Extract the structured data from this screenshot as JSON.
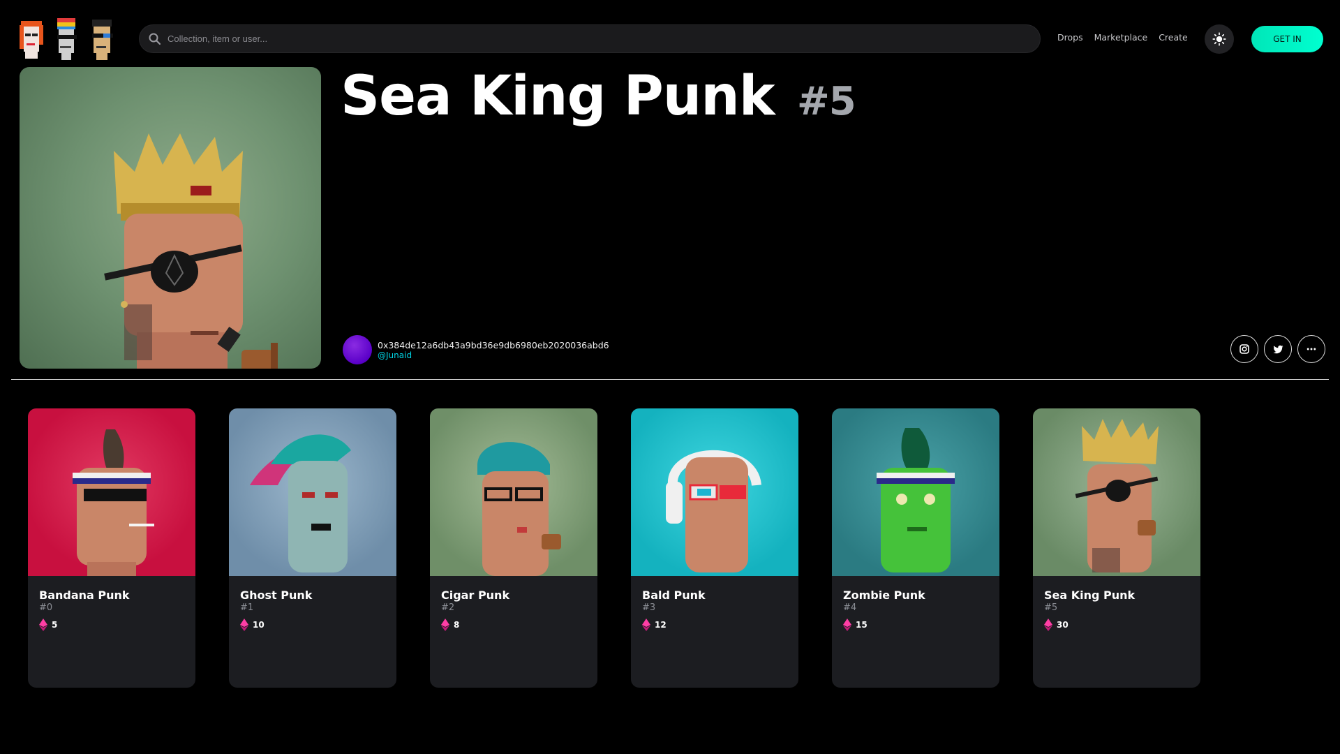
{
  "header": {
    "search_placeholder": "Collection, item or user...",
    "nav": [
      {
        "label": "Drops"
      },
      {
        "label": "Marketplace"
      },
      {
        "label": "Create"
      }
    ],
    "get_in_label": "GET IN",
    "accent_color": "#00f0c8"
  },
  "hero": {
    "title": "Sea King Punk",
    "number": "#5",
    "owner_address": "0x384de12a6db43a9bd36e9db6980eb2020036abd6",
    "owner_handle": "@Junaid",
    "socials": [
      {
        "icon": "instagram-icon"
      },
      {
        "icon": "twitter-icon"
      },
      {
        "icon": "more-icon"
      }
    ]
  },
  "cards": [
    {
      "title": "Bandana Punk",
      "number": "#0",
      "price": "5",
      "bg": "#d21447"
    },
    {
      "title": "Ghost Punk",
      "number": "#1",
      "price": "10",
      "bg": "#7e9bb4"
    },
    {
      "title": "Cigar Punk",
      "number": "#2",
      "price": "8",
      "bg": "#85a17c"
    },
    {
      "title": "Bald Punk",
      "number": "#3",
      "price": "12",
      "bg": "#1fc4cf"
    },
    {
      "title": "Zombie Punk",
      "number": "#4",
      "price": "15",
      "bg": "#3f8a90"
    },
    {
      "title": "Sea King Punk",
      "number": "#5",
      "price": "30",
      "bg": "#7d9c79"
    }
  ]
}
